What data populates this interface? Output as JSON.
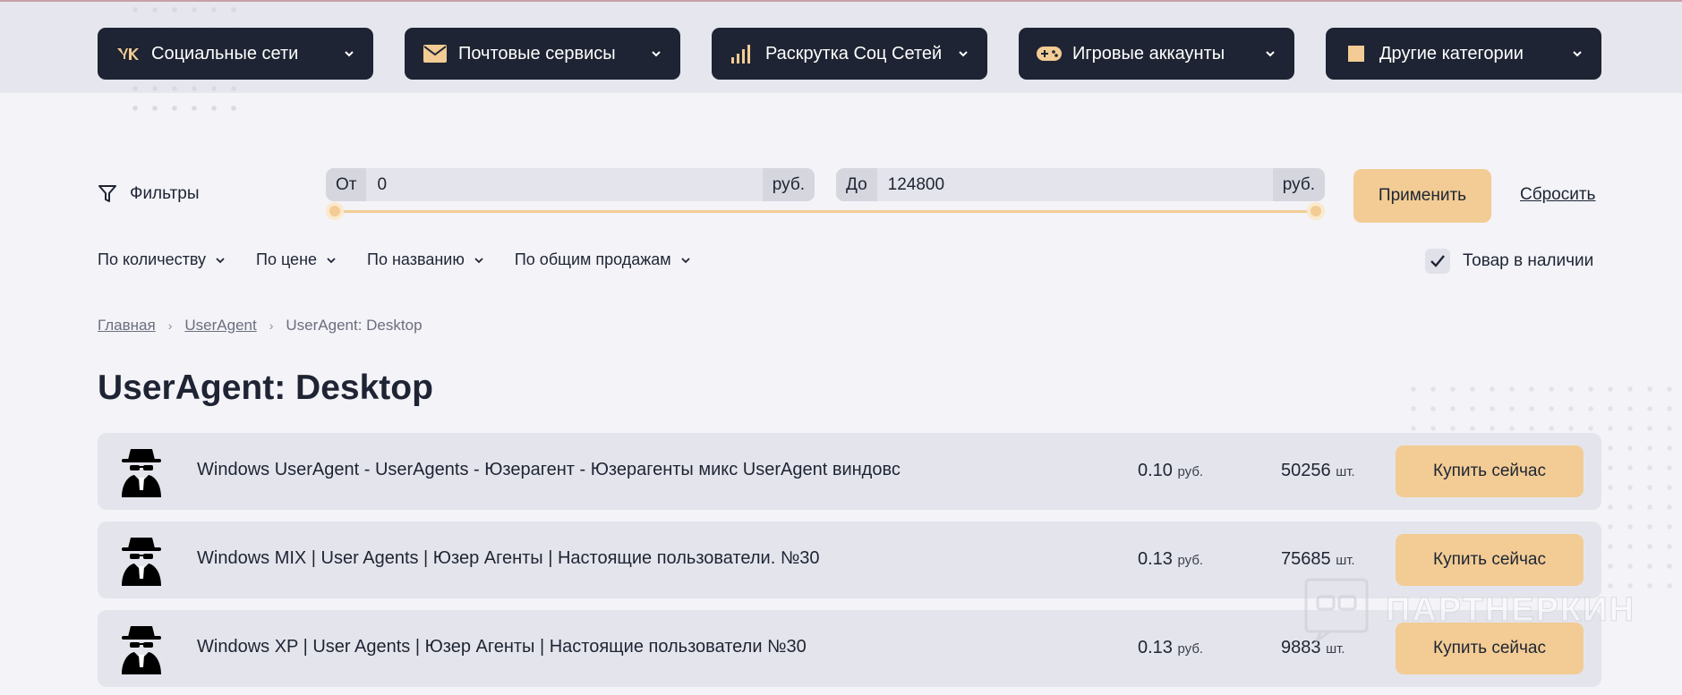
{
  "categories": [
    {
      "label": "Социальные сети",
      "icon": "vk-icon"
    },
    {
      "label": "Почтовые сервисы",
      "icon": "envelope-icon"
    },
    {
      "label": "Раскрутка Соц Сетей",
      "icon": "signal-bars-icon"
    },
    {
      "label": "Игровые аккаунты",
      "icon": "gamepad-icon"
    },
    {
      "label": "Другие категории",
      "icon": "square-icon"
    }
  ],
  "filters": {
    "label": "Фильтры",
    "from_label": "От",
    "from_value": "0",
    "to_label": "До",
    "to_value": "124800",
    "unit": "руб.",
    "apply_label": "Применить",
    "reset_label": "Сбросить"
  },
  "sort": [
    {
      "label": "По количеству"
    },
    {
      "label": "По цене"
    },
    {
      "label": "По названию"
    },
    {
      "label": "По общим продажам"
    }
  ],
  "stock_check": {
    "label": "Товар в наличии",
    "checked": true
  },
  "breadcrumb": {
    "home": "Главная",
    "parent": "UserAgent",
    "current": "UserAgent: Desktop"
  },
  "page_title": "UserAgent: Desktop",
  "products": [
    {
      "name": "Windows UserAgent - UserAgents - Юзерагент - Юзерагенты микс UserAgent виндовс",
      "price": "0.10",
      "price_unit": "руб.",
      "qty": "50256",
      "qty_unit": "шт.",
      "buy_label": "Купить сейчас"
    },
    {
      "name": "Windows MIX | User Agents | Юзер Агенты | Настоящие пользователи. №30",
      "price": "0.13",
      "price_unit": "руб.",
      "qty": "75685",
      "qty_unit": "шт.",
      "buy_label": "Купить сейчас"
    },
    {
      "name": "Windows XP | User Agents | Юзер Агенты | Настоящие пользователи №30",
      "price": "0.13",
      "price_unit": "руб.",
      "qty": "9883",
      "qty_unit": "шт.",
      "buy_label": "Купить сейчас"
    }
  ],
  "watermark": "ПАРТНЕРКИН",
  "colors": {
    "dark": "#1e2433",
    "accent": "#f2cc94",
    "row_bg": "#e4e5ec"
  }
}
